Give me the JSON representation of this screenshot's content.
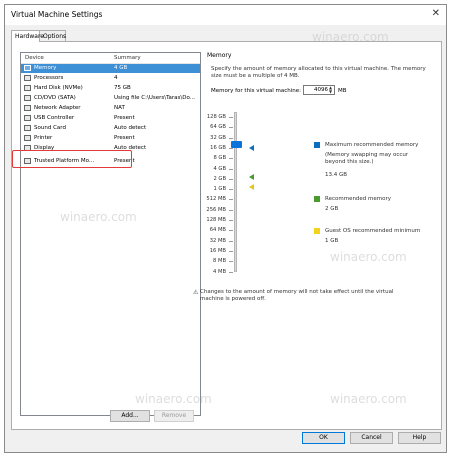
{
  "window": {
    "title": "Virtual Machine Settings"
  },
  "tabs": [
    {
      "label": "Hardware",
      "active": true
    },
    {
      "label": "Options",
      "active": false
    }
  ],
  "device_list": {
    "headers": {
      "device": "Device",
      "summary": "Summary"
    },
    "items": [
      {
        "name": "Memory",
        "summary": "4 GB",
        "icon": "memory-icon",
        "selected": true
      },
      {
        "name": "Processors",
        "summary": "4",
        "icon": "processor-icon"
      },
      {
        "name": "Hard Disk (NVMe)",
        "summary": "75 GB",
        "icon": "hard-disk-icon"
      },
      {
        "name": "CD/DVD (SATA)",
        "summary": "Using file C:\\Users\\Taras\\Do...",
        "icon": "cd-dvd-icon"
      },
      {
        "name": "Network Adapter",
        "summary": "NAT",
        "icon": "network-icon"
      },
      {
        "name": "USB Controller",
        "summary": "Present",
        "icon": "usb-icon"
      },
      {
        "name": "Sound Card",
        "summary": "Auto detect",
        "icon": "sound-icon"
      },
      {
        "name": "Printer",
        "summary": "Present",
        "icon": "printer-icon"
      },
      {
        "name": "Display",
        "summary": "Auto detect",
        "icon": "display-icon"
      },
      {
        "name": "Trusted Platform Mo...",
        "summary": "Present",
        "icon": "tpm-icon"
      }
    ]
  },
  "list_buttons": {
    "add": "Add...",
    "remove": "Remove"
  },
  "memory": {
    "legend": "Memory",
    "description": "Specify the amount of memory allocated to this virtual machine. The memory size must be a multiple of 4 MB.",
    "field_label": "Memory for this virtual machine:",
    "value": "4096",
    "unit": "MB",
    "scale": [
      "128 GB",
      "64 GB",
      "32 GB",
      "16 GB",
      "8 GB",
      "4 GB",
      "2 GB",
      "1 GB",
      "512 MB",
      "256 MB",
      "128 MB",
      "64 MB",
      "32 MB",
      "16 MB",
      "8 MB",
      "4 MB"
    ],
    "max_recommended": {
      "label": "Maximum recommended memory",
      "note": "(Memory swapping may occur beyond this size.)",
      "value": "13.4 GB",
      "color": "#0b6fbf"
    },
    "recommended": {
      "label": "Recommended memory",
      "value": "2 GB",
      "color": "#4a9a2e"
    },
    "guest_min": {
      "label": "Guest OS recommended minimum",
      "value": "1 GB",
      "color": "#f2d21a"
    },
    "warning": "Changes to the amount of memory will not take effect until the virtual machine is powered off."
  },
  "footer_buttons": {
    "ok": "OK",
    "cancel": "Cancel",
    "help": "Help"
  },
  "watermark": "winaero.com"
}
